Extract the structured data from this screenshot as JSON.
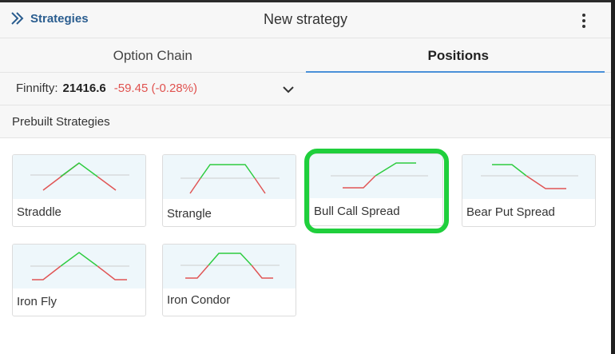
{
  "header": {
    "back_label": "Strategies",
    "title": "New strategy"
  },
  "tabs": [
    {
      "label": "Option Chain",
      "active": false
    },
    {
      "label": "Positions",
      "active": true
    }
  ],
  "index": {
    "name": "Finnifty:",
    "value": "21416.6",
    "change": "-59.45 (-0.28%)"
  },
  "section": {
    "label": "Prebuilt Strategies"
  },
  "strategies": [
    {
      "label": "Straddle"
    },
    {
      "label": "Strangle"
    },
    {
      "label": "Bull Call Spread",
      "highlighted": true
    },
    {
      "label": "Bear Put Spread"
    },
    {
      "label": "Iron Fly"
    },
    {
      "label": "Iron Condor"
    }
  ],
  "colors": {
    "accent": "#2a5d8f",
    "tab_underline": "#4a90d9",
    "negative": "#e0524f",
    "profit": "#2ecc40",
    "loss": "#e05555",
    "highlight": "#1fcf3c"
  }
}
